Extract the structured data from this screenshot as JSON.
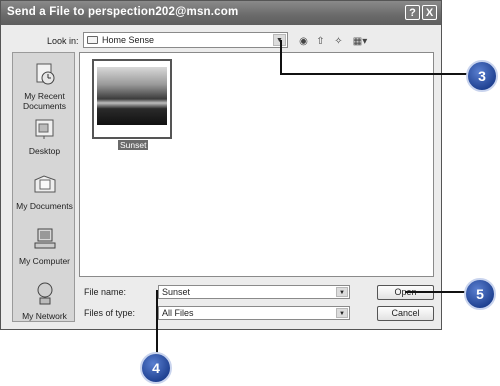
{
  "window": {
    "title": "Send a File to perspection202@msn.com",
    "help_label": "?",
    "close_label": "X"
  },
  "lookin": {
    "label": "Look in:",
    "value": "Home Sense"
  },
  "toolbar": {
    "icons": [
      "back-icon",
      "up-folder-icon",
      "new-folder-icon",
      "views-menu-icon"
    ]
  },
  "places": [
    {
      "label": "My Recent Documents",
      "icon": "recent-documents-icon"
    },
    {
      "label": "Desktop",
      "icon": "desktop-icon"
    },
    {
      "label": "My Documents",
      "icon": "my-documents-icon"
    },
    {
      "label": "My Computer",
      "icon": "my-computer-icon"
    },
    {
      "label": "My Network",
      "icon": "my-network-icon"
    }
  ],
  "files": [
    {
      "name": "Sunset",
      "selected": true
    }
  ],
  "filename": {
    "label": "File name:",
    "value": "Sunset"
  },
  "filetype": {
    "label": "Files of type:",
    "value": "All Files"
  },
  "buttons": {
    "open": "Open",
    "cancel": "Cancel"
  },
  "callouts": [
    "3",
    "4",
    "5"
  ],
  "colors": {
    "callout": "#2a4a9c"
  }
}
